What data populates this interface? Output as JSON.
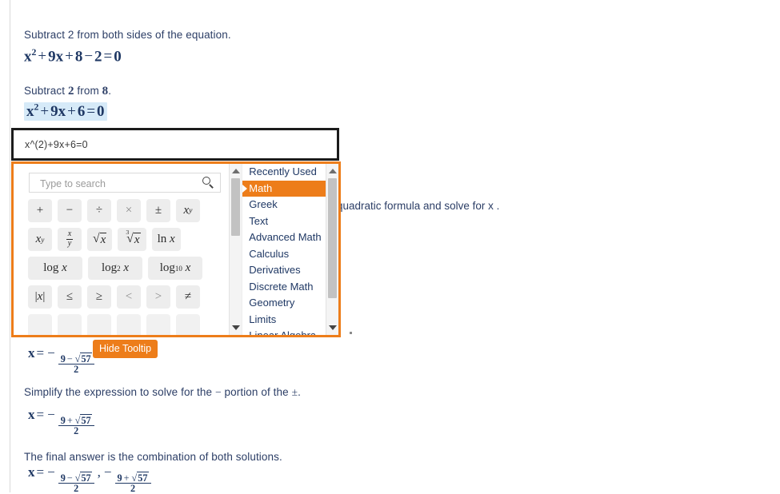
{
  "document": {
    "steps": [
      {
        "id": "step1",
        "text": "Subtract 2 from both sides of the equation."
      },
      {
        "id": "step2",
        "text": "Subtract 2 from 8."
      }
    ],
    "step2_prefix": "Subtract",
    "step2_num1": "2",
    "step2_mid": "from",
    "step2_num2": "8",
    "step2_period": ".",
    "equation_1": "x² + 9x + 8 − 2 = 0",
    "equation_2_highlighted": "x² + 9x + 6 = 0",
    "partial_text_behind_panel": "quadratic formula and solve for x .",
    "simplify_text": "Simplify the expression to solve for the − portion of the ± .",
    "final_text": "The final answer is the combination of both solutions.",
    "solution_minus": "x = − (9 − √57) / 2",
    "solution_plus": "x = − (9 + √57) / 2",
    "solution_both": "x = − (9 − √57)/2 , − (9 + √57)/2"
  },
  "equation_input": {
    "value": "x^(2)+9x+6=0",
    "placeholder": ""
  },
  "palette": {
    "search": {
      "placeholder": "Type to search",
      "value": "",
      "icon": "search-icon"
    },
    "rows": [
      {
        "buttons": [
          {
            "name": "plus",
            "label": "+"
          },
          {
            "name": "minus",
            "label": "−"
          },
          {
            "name": "divide",
            "label": "÷"
          },
          {
            "name": "multiply",
            "label": "×"
          },
          {
            "name": "plus-minus",
            "label": "±"
          },
          {
            "name": "power",
            "label": "x^y"
          }
        ]
      },
      {
        "buttons": [
          {
            "name": "subscript",
            "label": "x_y"
          },
          {
            "name": "fraction",
            "label": "x/y"
          },
          {
            "name": "square-root",
            "label": "√x"
          },
          {
            "name": "cube-root",
            "label": "∛x"
          },
          {
            "name": "natural-log",
            "label": "ln x"
          }
        ]
      },
      {
        "buttons": [
          {
            "name": "log",
            "label": "log x"
          },
          {
            "name": "log-base-2",
            "label": "log₂ x"
          },
          {
            "name": "log-base-10",
            "label": "log₁₀ x"
          }
        ]
      },
      {
        "buttons": [
          {
            "name": "absolute-value",
            "label": "|x|"
          },
          {
            "name": "less-equal",
            "label": "≤"
          },
          {
            "name": "greater-equal",
            "label": "≥"
          },
          {
            "name": "less-than",
            "label": "<"
          },
          {
            "name": "greater-than",
            "label": ">"
          },
          {
            "name": "not-equal",
            "label": "≠"
          }
        ]
      }
    ],
    "categories": [
      {
        "label": "Recently Used",
        "selected": false
      },
      {
        "label": "Math",
        "selected": true
      },
      {
        "label": "Greek",
        "selected": false
      },
      {
        "label": "Text",
        "selected": false
      },
      {
        "label": "Advanced Math",
        "selected": false
      },
      {
        "label": "Calculus",
        "selected": false
      },
      {
        "label": "Derivatives",
        "selected": false
      },
      {
        "label": "Discrete Math",
        "selected": false
      },
      {
        "label": "Geometry",
        "selected": false
      },
      {
        "label": "Limits",
        "selected": false
      },
      {
        "label": "Linear Algebra",
        "selected": false
      }
    ]
  },
  "tooltip_button": {
    "label": "Hide Tooltip"
  },
  "colors": {
    "accent_orange": "#ed7d1a",
    "highlight_blue": "#d6eaf8",
    "text_navy": "#2c3e66",
    "button_grey": "#ededed"
  }
}
